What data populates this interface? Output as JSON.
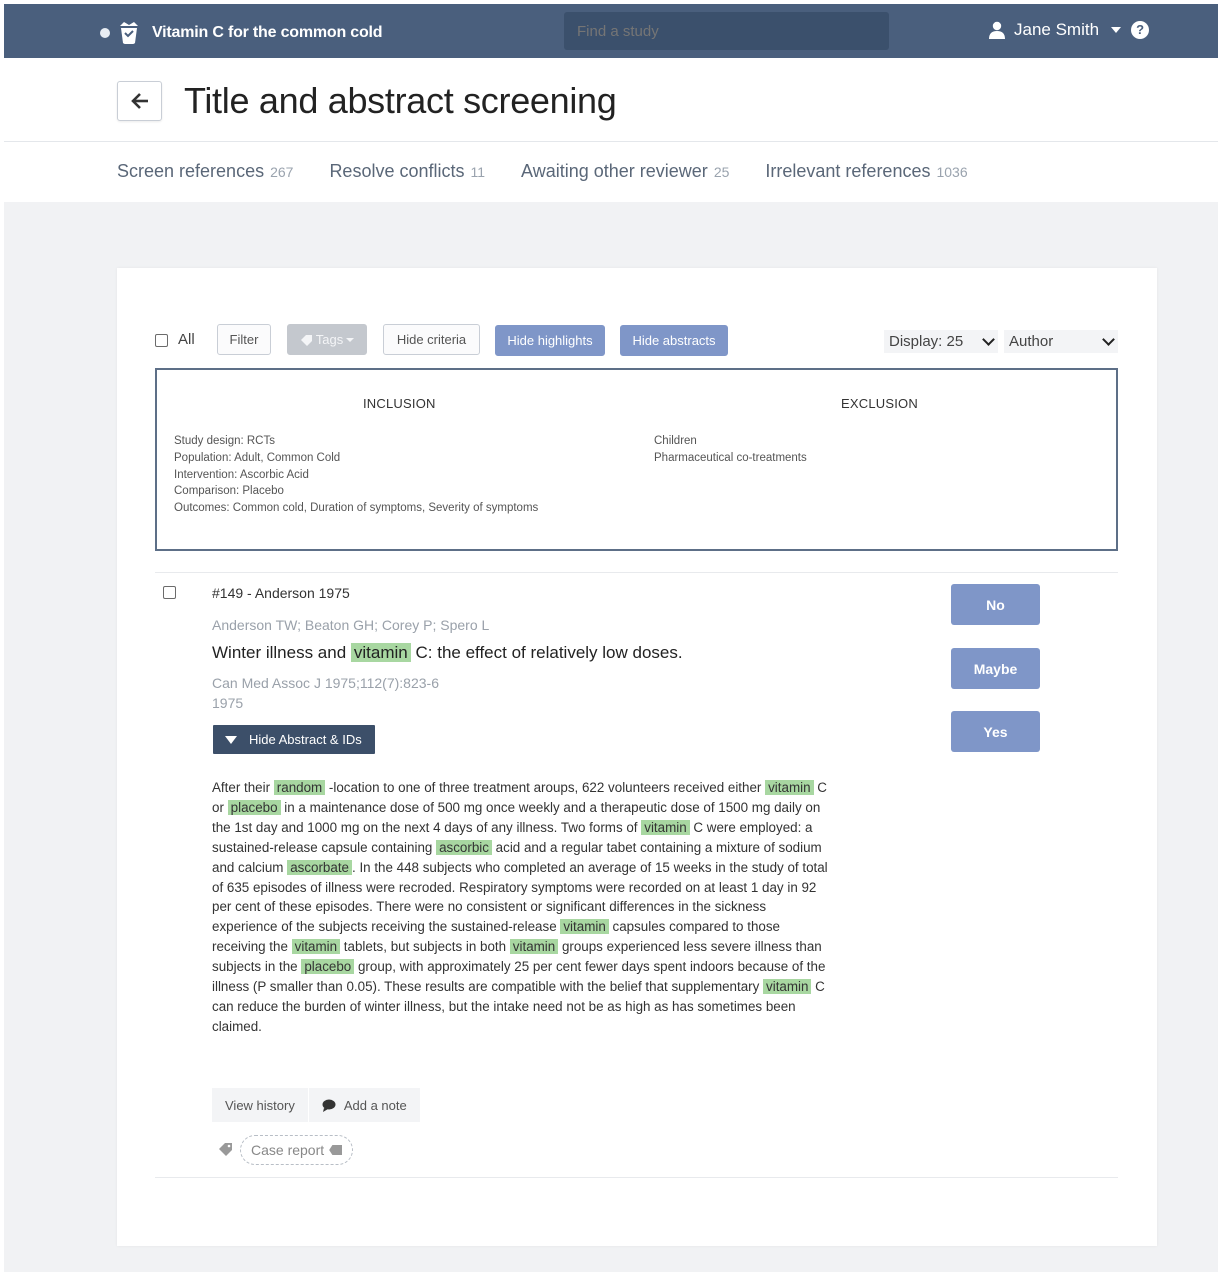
{
  "topbar": {
    "project_title": "Vitamin C for the common cold",
    "search_placeholder": "Find a study",
    "user_name": "Jane Smith",
    "help_label": "?"
  },
  "header": {
    "title": "Title and abstract screening"
  },
  "tabs": [
    {
      "label": "Screen references",
      "count": "267"
    },
    {
      "label": "Resolve conflicts",
      "count": "11"
    },
    {
      "label": "Awaiting other reviewer",
      "count": "25"
    },
    {
      "label": "Irrelevant references",
      "count": "1036"
    }
  ],
  "toolbar": {
    "all_label": "All",
    "filter_label": "Filter",
    "tags_label": "Tags",
    "hide_criteria_label": "Hide criteria",
    "hide_highlights_label": "Hide highlights",
    "hide_abstracts_label": "Hide abstracts",
    "display_value": "Display: 25",
    "sort_value": "Author"
  },
  "criteria": {
    "inclusion_heading": "INCLUSION",
    "exclusion_heading": "EXCLUSION",
    "inclusion": [
      "Study design: RCTs",
      "Population: Adult, Common Cold",
      "Intervention: Ascorbic Acid",
      "Comparison: Placebo",
      "Outcomes: Common cold, Duration of symptoms, Severity of symptoms"
    ],
    "exclusion": [
      "Children",
      "Pharmaceutical co-treatments"
    ]
  },
  "reference": {
    "id_line": "#149 - Anderson 1975",
    "authors": "Anderson TW; Beaton GH; Corey P; Spero L",
    "title_before": "Winter illness and",
    "title_highlight": "vitamin",
    "title_after": "C: the effect of relatively low doses.",
    "journal": "Can Med Assoc J 1975;112(7):823-6",
    "year": "1975",
    "hide_abstract_label": "Hide Abstract & IDs",
    "abstract_segments": [
      {
        "text": "After their "
      },
      {
        "text": "random",
        "hl": true
      },
      {
        "text": " -location to one of three treatment aroups, 622 volunteers received either "
      },
      {
        "text": "vitamin",
        "hl": true
      },
      {
        "text": " C or "
      },
      {
        "text": "placebo",
        "hl": true
      },
      {
        "text": " in a maintenance dose of 500 mg once weekly and a therapeutic dose of 1500 mg daily on the 1st day and 1000 mg on the next 4 days of any illness. Two forms of "
      },
      {
        "text": "vitamin",
        "hl": true
      },
      {
        "text": " C were employed: a sustained-release capsule containing "
      },
      {
        "text": "ascorbic",
        "hl": true
      },
      {
        "text": " acid and a regular tabet containing a mixture of sodium and calcium "
      },
      {
        "text": "ascorbate",
        "hl": true
      },
      {
        "text": ". In the 448 subjects who completed an average of 15 weeks in the study of total of 635 episodes of illness were recroded. Respiratory symptoms were recorded on at least 1 day in 92 per cent of these episodes. There were no consistent or significant differences in the sickness experience of the subjects receiving the sustained-release "
      },
      {
        "text": "vitamin",
        "hl": true
      },
      {
        "text": " capsules compared to those receiving the "
      },
      {
        "text": "vitamin",
        "hl": true
      },
      {
        "text": " tablets, but subjects in both "
      },
      {
        "text": "vitamin",
        "hl": true
      },
      {
        "text": " groups experienced less severe illness than subjects in the "
      },
      {
        "text": "placebo",
        "hl": true
      },
      {
        "text": " group, with approximately 25 per cent fewer days spent indoors because of the illness (P smaller than 0.05). These results are compatible with the belief that supplementary "
      },
      {
        "text": "vitamin",
        "hl": true
      },
      {
        "text": " C can reduce the burden of winter illness, but the intake need not be as high as has sometimes been claimed."
      }
    ],
    "decisions": {
      "no": "No",
      "maybe": "Maybe",
      "yes": "Yes"
    },
    "view_history_label": "View history",
    "add_note_label": "Add a note",
    "tag_label": "Case report"
  },
  "colors": {
    "topbar": "#4a5f7d",
    "accent": "#7f96c8",
    "highlight": "#a8d7a1",
    "dark_button": "#3c4f69"
  }
}
